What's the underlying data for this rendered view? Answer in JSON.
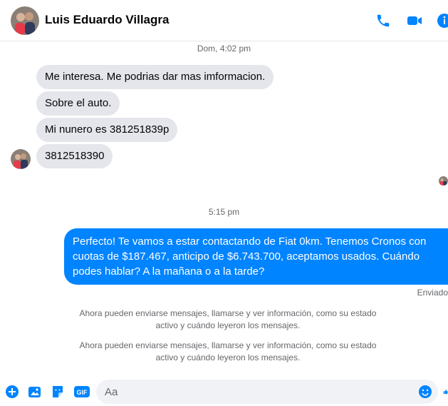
{
  "header": {
    "contact_name": "Luis Eduardo Villagra",
    "icons": [
      "phone-icon",
      "video-camera-icon",
      "info-icon"
    ],
    "accent_color": "#0084ff"
  },
  "conversation": {
    "timestamp_1": "Dom, 4:02 pm",
    "incoming": [
      "Me interesa. Me podrias dar mas imformacion.",
      "Sobre el auto.",
      "Mi nunero es 381251839p",
      "3812518390"
    ],
    "timestamp_2": "5:15 pm",
    "outgoing": "Perfecto! Te vamos a estar contactando de Fiat 0km. Tenemos Cronos con cuotas de $187.467, anticipo de $6.743.700, aceptamos usados. Cuándo podes hablar? A la mañana o a la tarde?",
    "status": "Enviado",
    "system_messages": [
      "Ahora pueden enviarse mensajes, llamarse y ver información, como su estado activo y cuándo leyeron los mensajes.",
      "Ahora pueden enviarse mensajes, llamarse y ver información, como su estado activo y cuándo leyeron los mensajes."
    ]
  },
  "composer": {
    "placeholder": "Aa",
    "icons": [
      "plus-circle-icon",
      "photo-icon",
      "sticker-icon",
      "gif-icon",
      "emoji-icon",
      "thumbs-up-icon"
    ]
  }
}
